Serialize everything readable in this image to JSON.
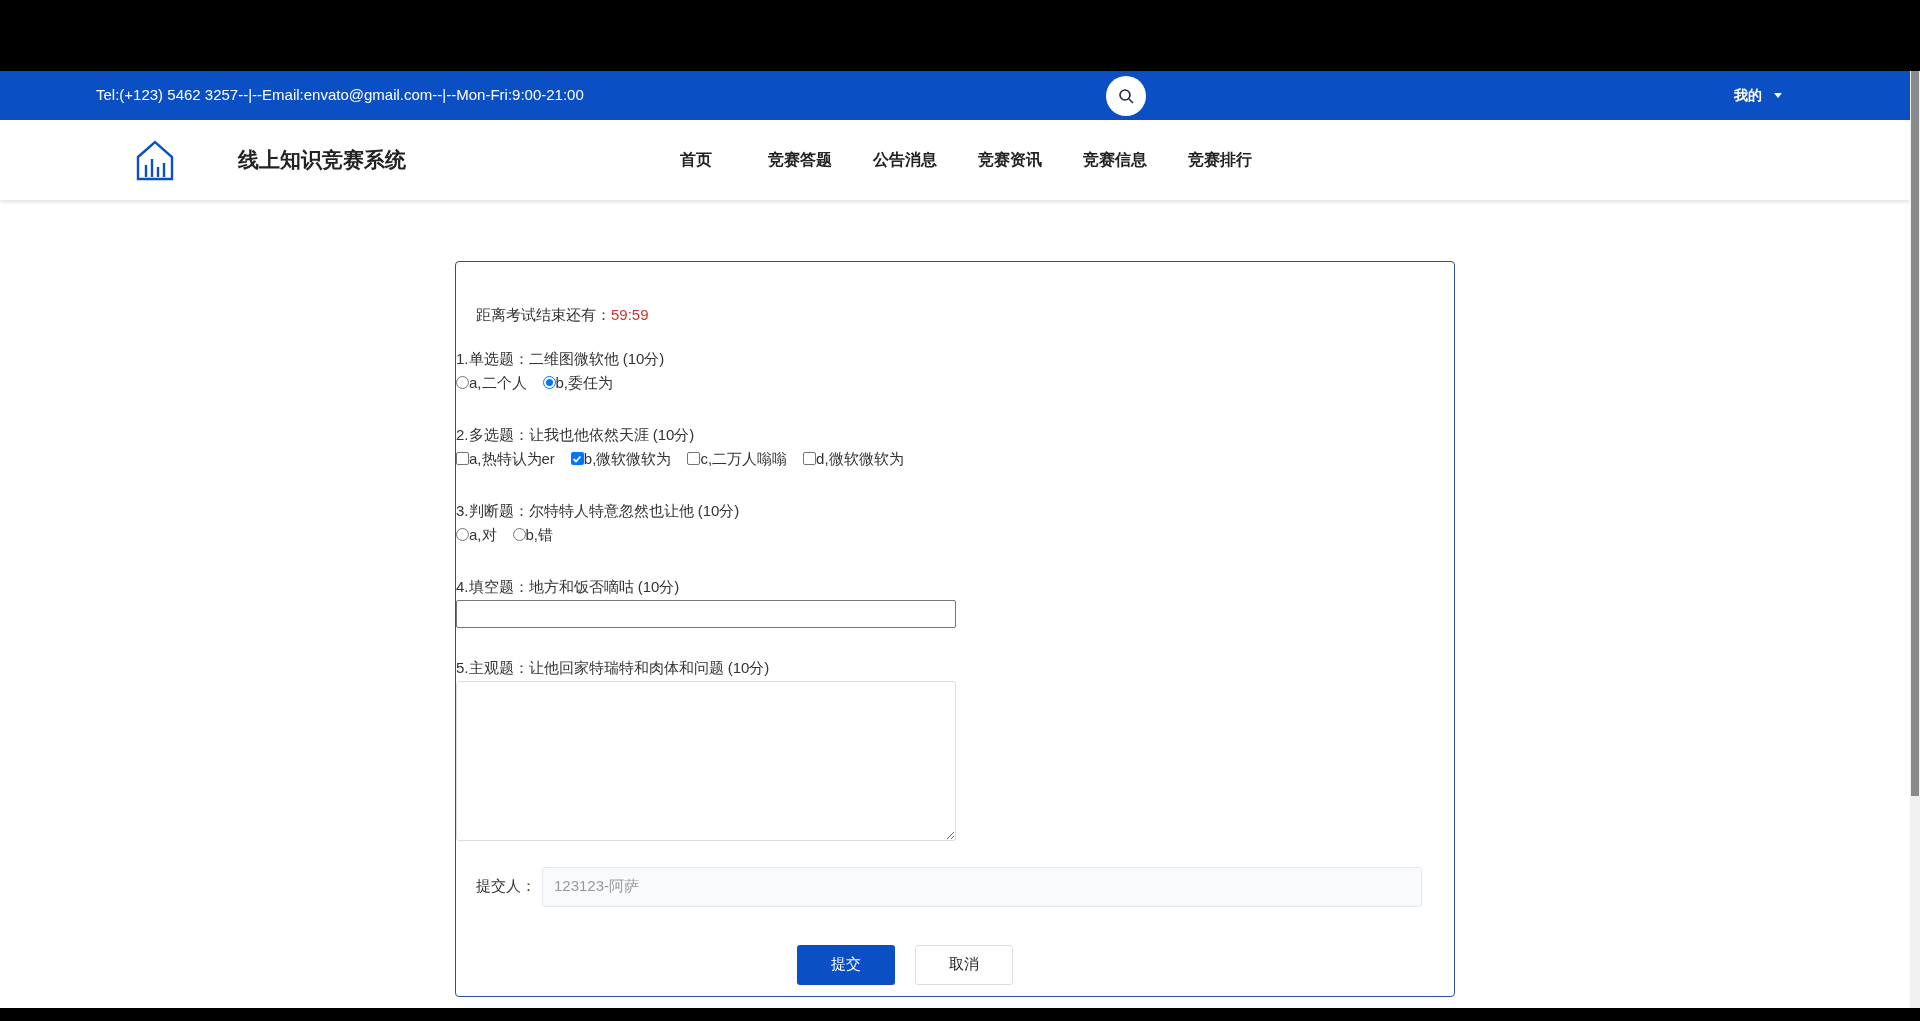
{
  "top_bar": {
    "contact": "Tel:(+123) 5462 3257--|--Email:envato@gmail.com--|--Mon-Fri:9:00-21:00",
    "user_menu": "我的"
  },
  "nav": {
    "site_title": "线上知识竞赛系统",
    "items": [
      "首页",
      "竞赛答题",
      "公告消息",
      "竞赛资讯",
      "竞赛信息",
      "竞赛排行"
    ]
  },
  "exam": {
    "timer_label": "距离考试结束还有：",
    "timer": "59:59",
    "questions": [
      {
        "kind": "radio",
        "title": "1.单选题：二维图微软他 (10分)",
        "options": [
          {
            "label": "a,二个人",
            "selected": false
          },
          {
            "label": "b,委任为",
            "selected": true
          }
        ]
      },
      {
        "kind": "checkbox",
        "title": "2.多选题：让我也他依然天涯 (10分)",
        "options": [
          {
            "label": "a,热特认为er",
            "checked": false
          },
          {
            "label": "b,微软微软为",
            "checked": true
          },
          {
            "label": "c,二万人嗡嗡",
            "checked": false
          },
          {
            "label": "d,微软微软为",
            "checked": false
          }
        ]
      },
      {
        "kind": "radio",
        "title": "3.判断题：尔特特人特意忽然也让他 (10分)",
        "options": [
          {
            "label": "a,对",
            "selected": false
          },
          {
            "label": "b,错",
            "selected": false
          }
        ]
      },
      {
        "kind": "fill",
        "title": "4.填空题：地方和饭否嘀咕 (10分)"
      },
      {
        "kind": "essay",
        "title": "5.主观题：让他回家特瑞特和肉体和问题 (10分)"
      }
    ]
  },
  "submitter": {
    "label": "提交人：",
    "value": "123123-阿萨",
    "disabled": true
  },
  "buttons": [
    {
      "label": "提交",
      "kind": "primary"
    },
    {
      "label": "取消",
      "kind": "default"
    }
  ]
}
